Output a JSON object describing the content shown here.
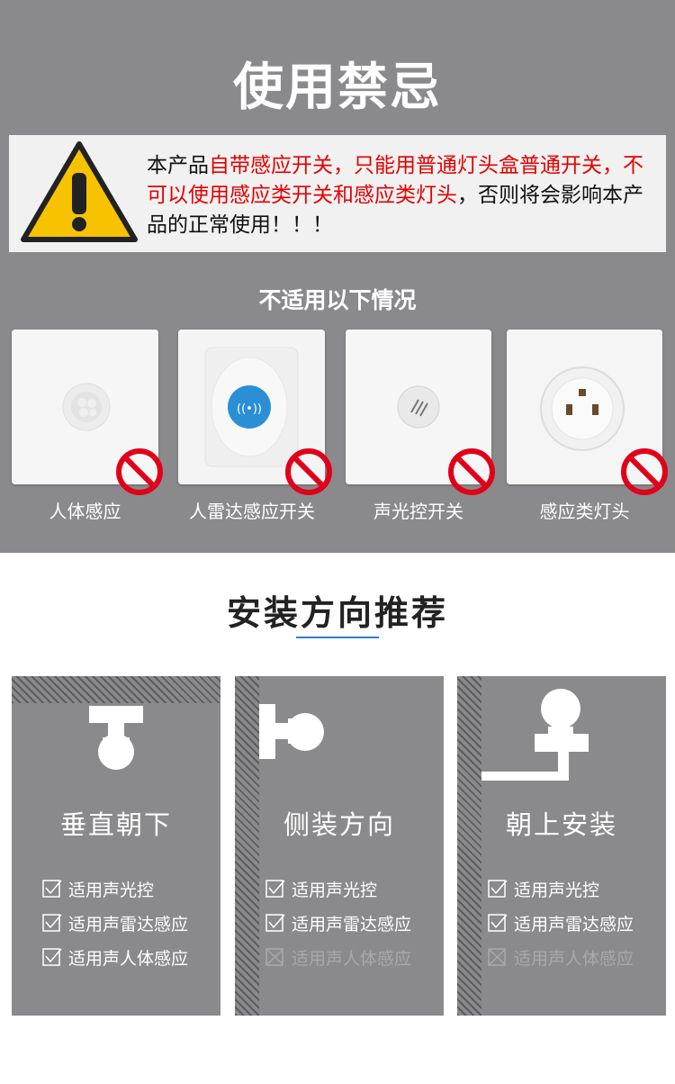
{
  "prohibitions": {
    "title": "使用禁忌",
    "warning": {
      "part1": "本产品",
      "part2": "自带感应开关，只能用普通灯头盒普通开关，不可以使用感应类开关和感应类灯头",
      "part3": "，否则将会影响本产品的正常使用！！！"
    },
    "subtitle": "不适用以下情况",
    "items": [
      {
        "label": "人体感应"
      },
      {
        "label": "人雷达感应开关"
      },
      {
        "label": "声光控开关"
      },
      {
        "label": "感应类灯头"
      }
    ]
  },
  "installation": {
    "title": "安装方向推荐",
    "accent_color": "#2f7fd2",
    "panels": [
      {
        "title": "垂直朝下",
        "features": [
          {
            "label": "适用声光控",
            "ok": true
          },
          {
            "label": "适用声雷达感应",
            "ok": true
          },
          {
            "label": "适用声人体感应",
            "ok": true
          }
        ]
      },
      {
        "title": "侧装方向",
        "features": [
          {
            "label": "适用声光控",
            "ok": true
          },
          {
            "label": "适用声雷达感应",
            "ok": true
          },
          {
            "label": "适用声人体感应",
            "ok": false
          }
        ]
      },
      {
        "title": "朝上安装",
        "features": [
          {
            "label": "适用声光控",
            "ok": true
          },
          {
            "label": "适用声雷达感应",
            "ok": true
          },
          {
            "label": "适用声人体感应",
            "ok": false
          }
        ]
      }
    ]
  },
  "colors": {
    "background_gray": "#8a8a8c",
    "warning_red": "#e30000",
    "prohibit_red": "#e0001a"
  },
  "icons": {
    "warning": "warning-triangle-icon",
    "prohibit": "prohibited-icon",
    "check": "checkbox-checked-icon",
    "cross": "checkbox-crossed-icon"
  }
}
